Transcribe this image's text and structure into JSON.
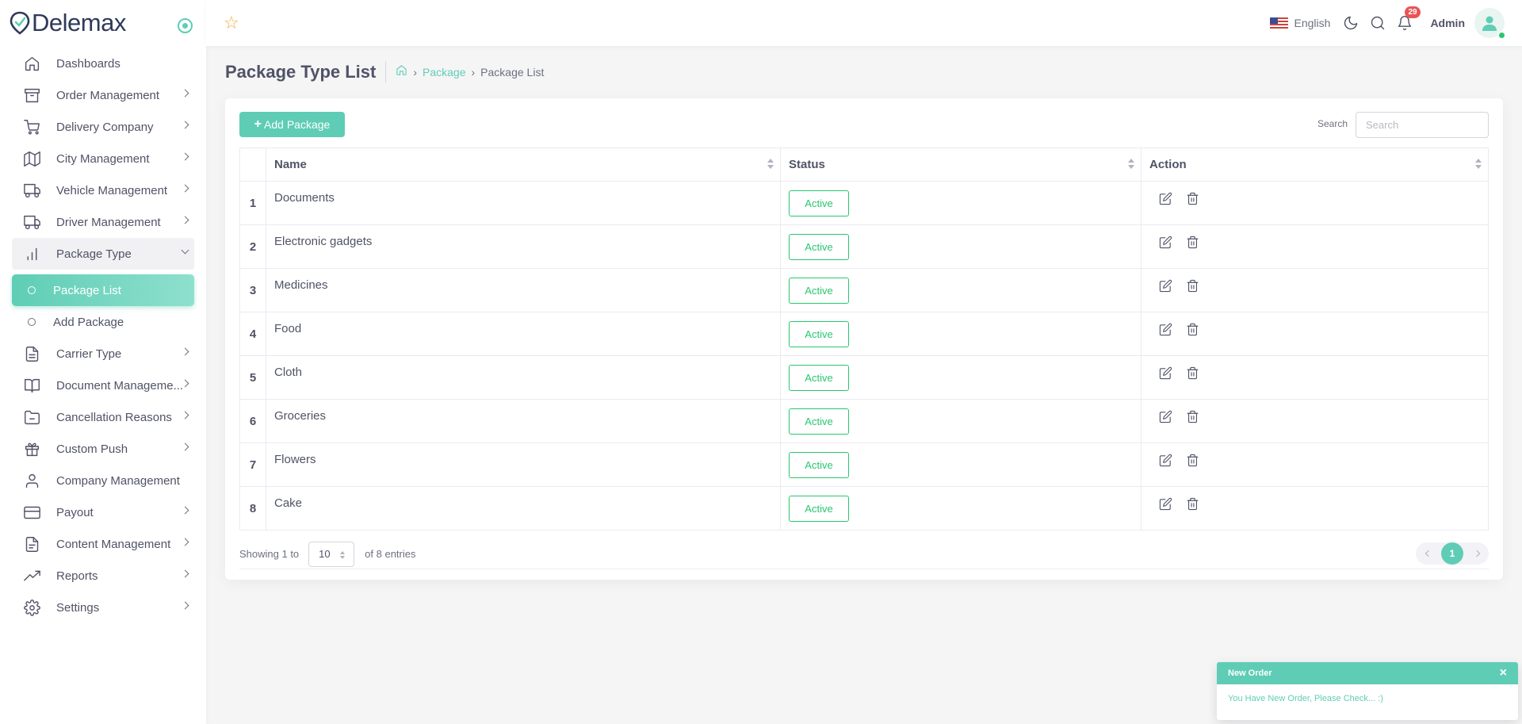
{
  "brand": {
    "name": "Delemax"
  },
  "colors": {
    "accent": "#5fcdb5",
    "success": "#28c76f",
    "badge": "#ea5455",
    "star": "#f2a93b"
  },
  "sidebar": {
    "items": [
      {
        "label": "Dashboards",
        "icon": "home-icon"
      },
      {
        "label": "Order Management",
        "icon": "archive-icon"
      },
      {
        "label": "Delivery Company",
        "icon": "cart-icon"
      },
      {
        "label": "City Management",
        "icon": "map-icon"
      },
      {
        "label": "Vehicle Management",
        "icon": "truck-icon"
      },
      {
        "label": "Driver Management",
        "icon": "truck-icon"
      },
      {
        "label": "Package Type",
        "icon": "bar-chart-icon"
      },
      {
        "label": "Carrier Type",
        "icon": "file-icon"
      },
      {
        "label": "Document Manageme...",
        "icon": "book-icon"
      },
      {
        "label": "Cancellation Reasons",
        "icon": "folder-minus-icon"
      },
      {
        "label": "Custom Push",
        "icon": "gift-icon"
      },
      {
        "label": "Company Management",
        "icon": "user-icon"
      },
      {
        "label": "Payout",
        "icon": "credit-card-icon"
      },
      {
        "label": "Content Management",
        "icon": "file-text-icon"
      },
      {
        "label": "Reports",
        "icon": "trending-up-icon"
      },
      {
        "label": "Settings",
        "icon": "gear-icon"
      }
    ],
    "sub": [
      {
        "label": "Package List"
      },
      {
        "label": "Add Package"
      }
    ]
  },
  "navbar": {
    "language": "English",
    "notifications": "29",
    "user": "Admin"
  },
  "header": {
    "title": "Package Type List",
    "crumb_link": "Package",
    "crumb_current": "Package List"
  },
  "toolbar": {
    "add_label": "Add Package",
    "search_label": "Search",
    "search_placeholder": "Search"
  },
  "table": {
    "columns": [
      "Name",
      "Status",
      "Action"
    ],
    "rows": [
      {
        "num": "1",
        "name": "Documents",
        "status": "Active"
      },
      {
        "num": "2",
        "name": "Electronic gadgets",
        "status": "Active"
      },
      {
        "num": "3",
        "name": "Medicines",
        "status": "Active"
      },
      {
        "num": "4",
        "name": "Food",
        "status": "Active"
      },
      {
        "num": "5",
        "name": "Cloth",
        "status": "Active"
      },
      {
        "num": "6",
        "name": "Groceries",
        "status": "Active"
      },
      {
        "num": "7",
        "name": "Flowers",
        "status": "Active"
      },
      {
        "num": "8",
        "name": "Cake",
        "status": "Active"
      }
    ]
  },
  "footer": {
    "showing": "Showing 1 to",
    "page_length": "10",
    "entries": "of 8 entries",
    "current_page": "1"
  },
  "toast": {
    "title": "New Order",
    "message": "You Have New Order, Please Check... :)"
  }
}
